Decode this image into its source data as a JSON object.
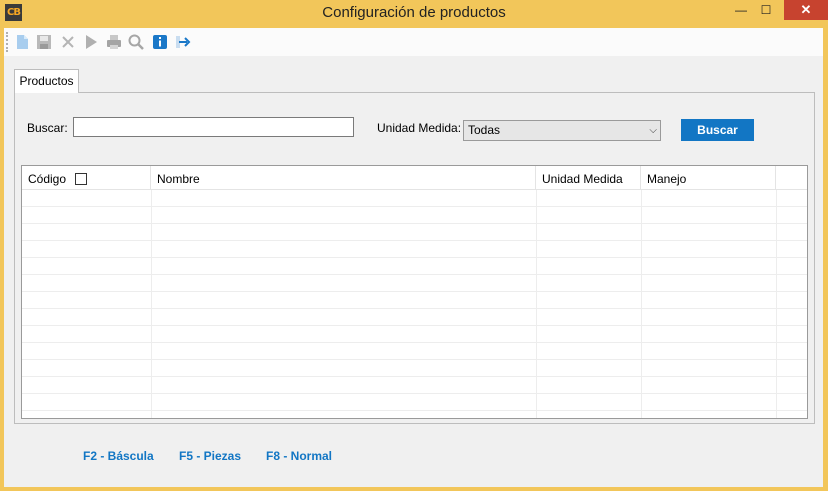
{
  "window": {
    "app_icon_text": "CB",
    "title": "Configuración de productos",
    "min_glyph": "—",
    "max_glyph": "☐",
    "close_glyph": "✕"
  },
  "toolbar": {
    "icons": [
      "new-document-icon",
      "save-icon",
      "delete-icon",
      "play-icon",
      "print-icon",
      "search-icon",
      "info-icon",
      "exit-icon"
    ]
  },
  "tabs": [
    {
      "label": "Productos"
    }
  ],
  "search": {
    "label": "Buscar:",
    "value": "",
    "unit_label": "Unidad Medida:",
    "unit_selected": "Todas",
    "button_label": "Buscar"
  },
  "table": {
    "columns": [
      "Código",
      "Nombre",
      "Unidad Medida",
      "Manejo"
    ],
    "rows": []
  },
  "legend": {
    "f2": "F2 - Báscula",
    "f5": "F5 - Piezas",
    "f8": "F8 - Normal"
  },
  "colors": {
    "titlebar": "#f2c65a",
    "accent": "#1276c4",
    "close": "#c7432f"
  }
}
